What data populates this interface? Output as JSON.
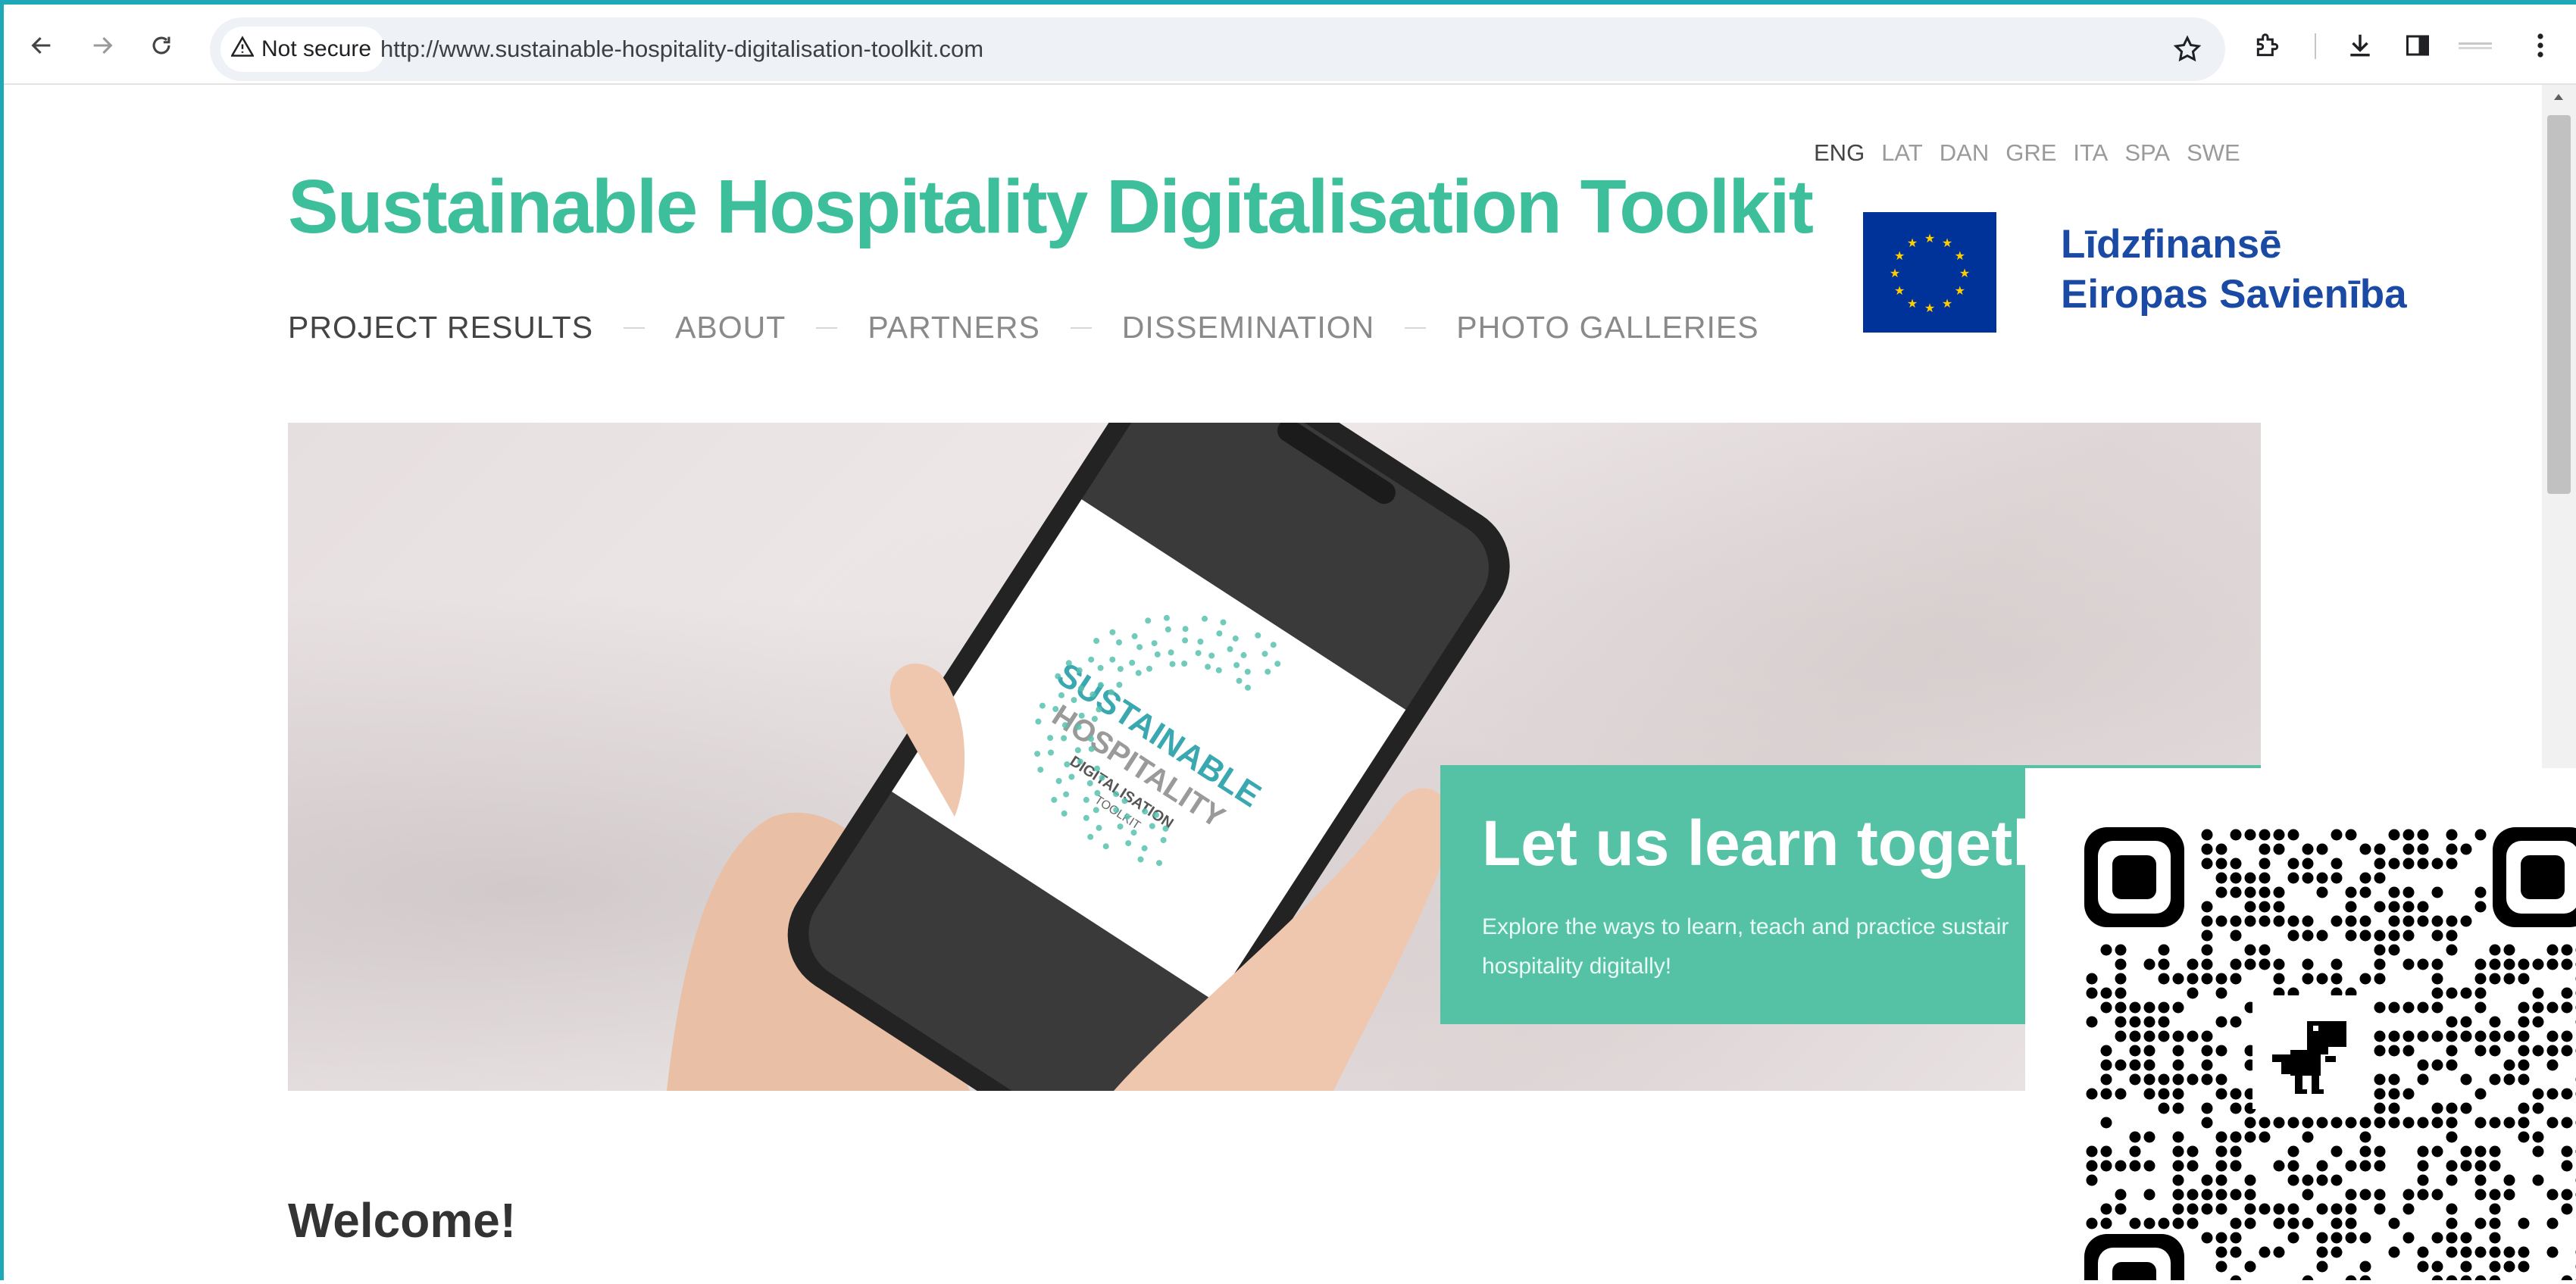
{
  "browser": {
    "security_label": "Not secure",
    "url": "http://www.sustainable-hospitality-digitalisation-toolkit.com",
    "icons": [
      "back-arrow-icon",
      "forward-arrow-icon",
      "reload-icon",
      "warning-icon",
      "star-icon",
      "extensions-icon",
      "download-icon",
      "side-panel-icon",
      "profile-icon",
      "menu-kebab-icon"
    ]
  },
  "site": {
    "title": "Sustainable Hospitality Digitalisation Toolkit",
    "nav": [
      "PROJECT RESULTS",
      "ABOUT",
      "PARTNERS",
      "DISSEMINATION",
      "PHOTO GALLERIES"
    ],
    "languages": [
      "ENG",
      "LAT",
      "DAN",
      "GRE",
      "ITA",
      "SPA",
      "SWE"
    ],
    "active_language": "ENG",
    "eu_logo": {
      "line1": "Līdzfinansē",
      "line2": "Eiropas Savienība"
    }
  },
  "hero": {
    "phone_logo": {
      "line1": "SUSTAINABLE",
      "line2": "HOSPITALITY",
      "line3": "DIGITALISATION",
      "line4": "TOOLKIT"
    },
    "cta_title": "Let us learn togethe",
    "cta_text": "Explore the ways to learn, teach and practice sustair hospitality digitally!"
  },
  "main": {
    "heading": "Welcome!"
  },
  "colors": {
    "brand_green": "#3dbf9c",
    "cta_green": "#55c2a6",
    "eu_blue": "#003399",
    "eu_star": "#ffcc00",
    "frame": "#1ea8b8"
  }
}
